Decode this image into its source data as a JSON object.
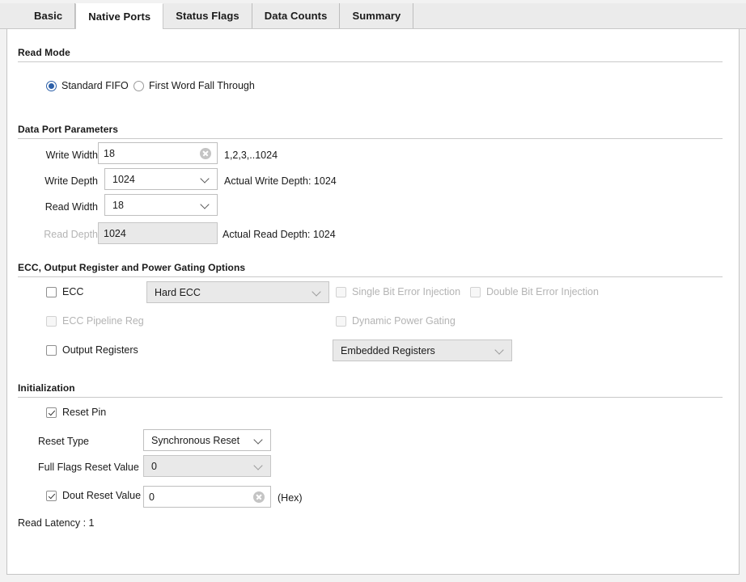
{
  "tabs": [
    {
      "label": "Basic",
      "active": false
    },
    {
      "label": "Native Ports",
      "active": true
    },
    {
      "label": "Status Flags",
      "active": false
    },
    {
      "label": "Data Counts",
      "active": false
    },
    {
      "label": "Summary",
      "active": false
    }
  ],
  "sections": {
    "read_mode": {
      "title": "Read Mode",
      "options": [
        {
          "label": "Standard FIFO",
          "selected": true
        },
        {
          "label": "First Word Fall Through",
          "selected": false
        }
      ]
    },
    "data_port": {
      "title": "Data Port Parameters",
      "write_width": {
        "label": "Write Width",
        "value": "18",
        "hint": "1,2,3,..1024"
      },
      "write_depth": {
        "label": "Write Depth",
        "value": "1024",
        "hint": "Actual Write Depth: 1024"
      },
      "read_width": {
        "label": "Read Width",
        "value": "18",
        "hint": ""
      },
      "read_depth": {
        "label": "Read Depth",
        "value": "1024",
        "hint": "Actual Read Depth: 1024"
      }
    },
    "ecc": {
      "title": "ECC, Output Register and Power Gating Options",
      "ecc_checkbox": {
        "label": "ECC",
        "checked": false
      },
      "ecc_mode": {
        "value": "Hard ECC"
      },
      "single_bit": {
        "label": "Single Bit Error Injection",
        "checked": false
      },
      "double_bit": {
        "label": "Double Bit Error Injection",
        "checked": false
      },
      "ecc_pipeline": {
        "label": "ECC Pipeline Reg",
        "checked": false
      },
      "dynamic_power_gating": {
        "label": "Dynamic Power Gating",
        "checked": false
      },
      "output_registers": {
        "label": "Output Registers",
        "checked": false
      },
      "output_reg_mode": {
        "value": "Embedded Registers"
      }
    },
    "initialization": {
      "title": "Initialization",
      "reset_pin": {
        "label": "Reset Pin",
        "checked": true
      },
      "reset_type": {
        "label": "Reset Type",
        "value": "Synchronous Reset"
      },
      "full_flags_reset": {
        "label": "Full Flags Reset Value",
        "value": "0"
      },
      "dout_reset": {
        "label": "Dout Reset Value",
        "checked": true,
        "value": "0",
        "suffix": "(Hex)"
      }
    },
    "footer": {
      "read_latency": "Read Latency : 1"
    }
  },
  "colors": {
    "accent": "#2b5fa8",
    "panel_bg": "#ffffff",
    "tabbar_bg": "#ebebeb",
    "disabled_bg": "#e9e9e9",
    "rule": "#c9c9c9"
  }
}
